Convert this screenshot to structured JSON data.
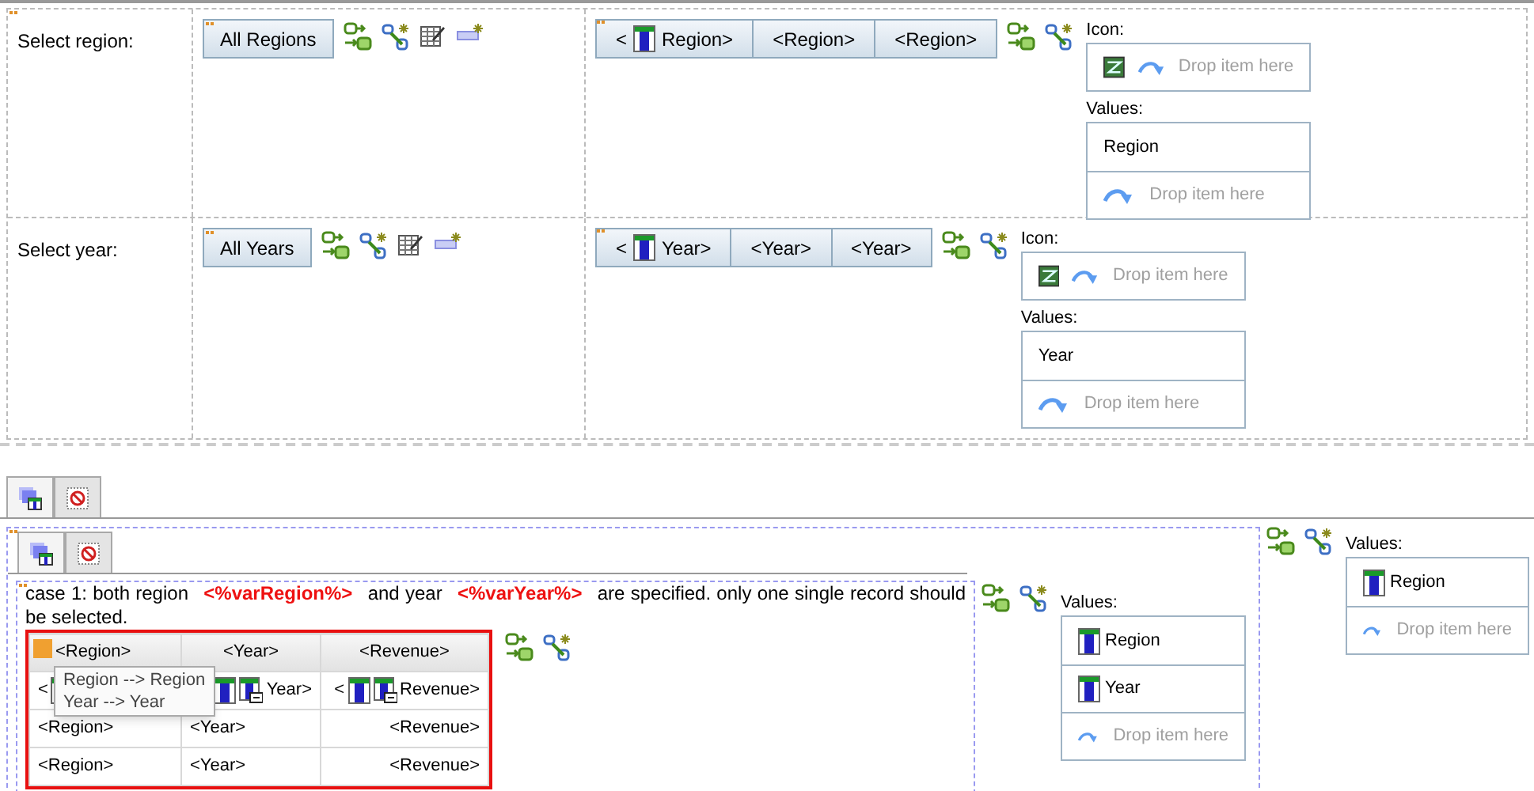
{
  "prompts": [
    {
      "label": "Select region:",
      "button": "All Regions",
      "list_items": [
        {
          "kind": "data_item",
          "prefix": "<",
          "text": "Region>"
        },
        {
          "kind": "plain",
          "text": "<Region>"
        },
        {
          "kind": "plain",
          "text": "<Region>"
        }
      ],
      "icon_label": "Icon:",
      "icon_drop": "Drop item here",
      "values_label": "Values:",
      "values": [
        {
          "kind": "plain",
          "text": "Region"
        },
        {
          "kind": "drop",
          "text": "Drop item here"
        }
      ]
    },
    {
      "label": "Select year:",
      "button": "All Years",
      "list_items": [
        {
          "kind": "data_item",
          "prefix": "<",
          "text": "Year>"
        },
        {
          "kind": "plain",
          "text": "<Year>"
        },
        {
          "kind": "plain",
          "text": "<Year>"
        }
      ],
      "icon_label": "Icon:",
      "icon_drop": "Drop item here",
      "values_label": "Values:",
      "values": [
        {
          "kind": "plain",
          "text": "Year"
        },
        {
          "kind": "drop",
          "text": "Drop item here"
        }
      ]
    }
  ],
  "outer_tabs": [
    {
      "kind": "layers",
      "selected": true
    },
    {
      "kind": "no_entry",
      "selected": false
    }
  ],
  "inner_tabs": [
    {
      "kind": "layers",
      "selected": true
    },
    {
      "kind": "no_entry",
      "selected": false
    }
  ],
  "case_text": "case 1: both region **<%varRegion%>** and year **<%varYear%>** are specified. only one single record should be selected.",
  "table": {
    "columns": [
      "<Region>",
      "<Year>",
      "<Revenue>"
    ],
    "rows": [
      [
        {
          "kind": "data_item",
          "prefix": "<"
        },
        {
          "kind": "data_item",
          "text": "Year>"
        },
        {
          "kind": "data_item",
          "prefix": "<",
          "text": "Revenue>"
        }
      ],
      [
        {
          "kind": "plain",
          "text": "<Region>"
        },
        {
          "kind": "plain",
          "text": "<Year>"
        },
        {
          "kind": "plain",
          "text": "<Revenue>"
        }
      ],
      [
        {
          "kind": "plain",
          "text": "<Region>"
        },
        {
          "kind": "plain",
          "text": "<Year>"
        },
        {
          "kind": "plain",
          "text": "<Revenue>"
        }
      ]
    ],
    "tooltip": [
      "Region --> Region",
      "Year --> Year"
    ]
  },
  "inner_values": {
    "label": "Values:",
    "items": [
      {
        "kind": "data_item",
        "text": "Region"
      },
      {
        "kind": "data_item",
        "text": "Year"
      },
      {
        "kind": "drop",
        "text": "Drop item here"
      }
    ]
  },
  "outer_values": {
    "label": "Values:",
    "items": [
      {
        "kind": "data_item",
        "text": "Region"
      },
      {
        "kind": "drop",
        "text": "Drop item here"
      }
    ]
  }
}
